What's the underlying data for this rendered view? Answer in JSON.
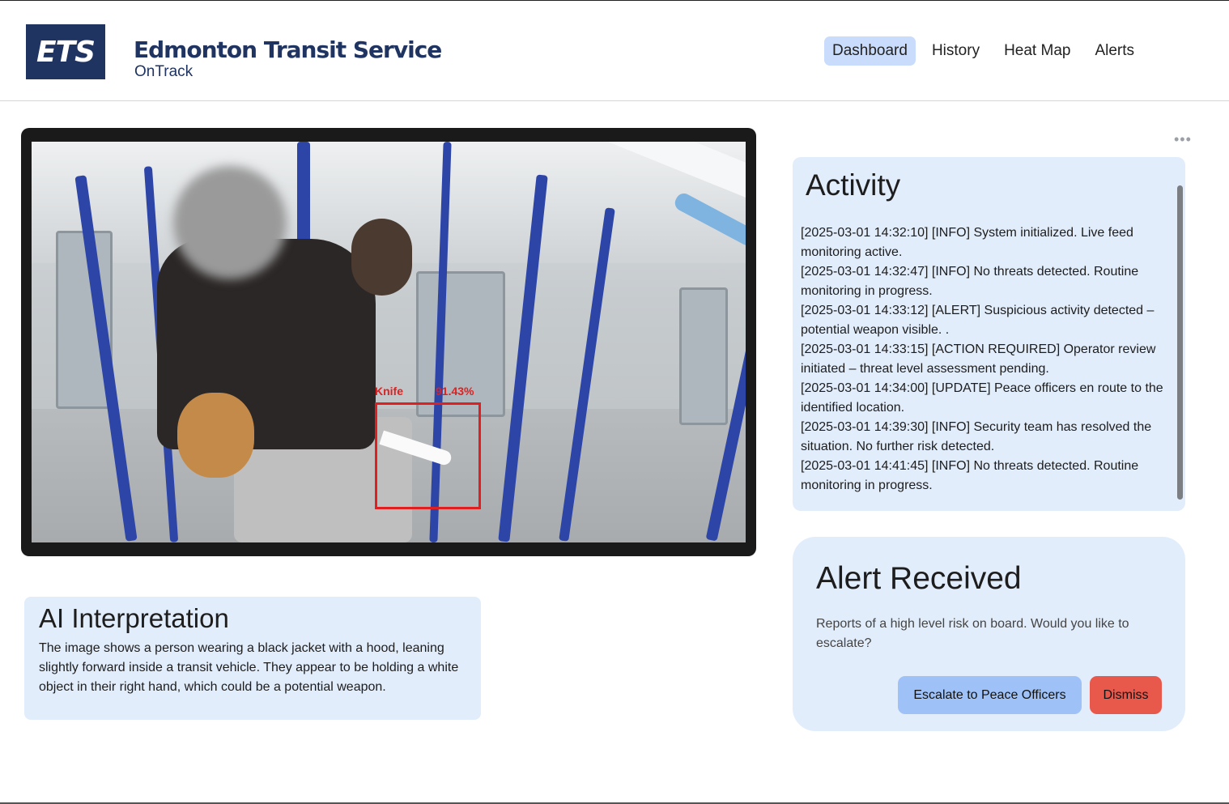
{
  "app": {
    "logo_text": "ETS",
    "title": "Edmonton Transit Service",
    "subtitle": "OnTrack"
  },
  "nav": {
    "items": [
      {
        "label": "Dashboard",
        "active": true
      },
      {
        "label": "History",
        "active": false
      },
      {
        "label": "Heat Map",
        "active": false
      },
      {
        "label": "Alerts",
        "active": false
      }
    ]
  },
  "camera": {
    "detection_label": "Knife",
    "detection_confidence": "91.43%",
    "box_color": "#e02020"
  },
  "ai_interpretation": {
    "title": "AI Interpretation",
    "body": "The image shows a person wearing a black jacket with a hood, leaning slightly forward inside a transit vehicle. They appear to be holding a white object in their right hand, which could be a potential weapon."
  },
  "activity": {
    "menu_icon": "more-horizontal-icon",
    "title": "Activity",
    "log": [
      "[2025-03-01 14:32:10] [INFO] System initialized. Live feed monitoring active.",
      "[2025-03-01 14:32:47] [INFO] No threats detected. Routine monitoring in progress.",
      "[2025-03-01 14:33:12] [ALERT] Suspicious activity detected – potential weapon visible.  .",
      "[2025-03-01 14:33:15] [ACTION REQUIRED] Operator review initiated – threat level assessment pending.",
      "[2025-03-01 14:34:00] [UPDATE] Peace officers en route to the identified location.",
      "[2025-03-01 14:39:30] [INFO] Security team has resolved the situation. No further risk detected.",
      "[2025-03-01 14:41:45] [INFO] No threats detected. Routine monitoring in progress."
    ]
  },
  "alert": {
    "title": "Alert Received",
    "message": "Reports of a high level risk on board. Would you like to escalate?",
    "escalate_label": "Escalate to Peace Officers",
    "dismiss_label": "Dismiss"
  },
  "colors": {
    "brand_navy": "#1f3461",
    "panel_bg": "#e2edfc",
    "nav_active_bg": "#c9dcfb",
    "escalate_bg": "#9ec2f7",
    "dismiss_bg": "#e8594c"
  }
}
